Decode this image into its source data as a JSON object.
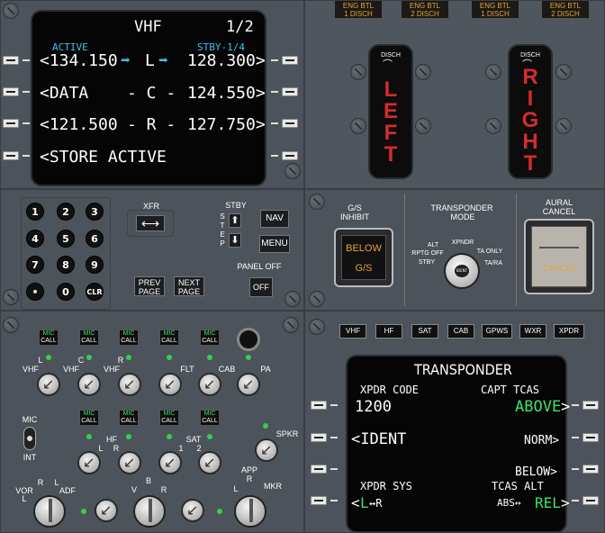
{
  "vhf": {
    "title": "VHF",
    "page": "1/2",
    "active_label": "ACTIVE",
    "stby_label": "STBY-1/4",
    "row1_left": "<134.150",
    "row1_mid": "L",
    "row1_right": "128.300>",
    "row2_left": "<DATA",
    "row2_mid": "- C -",
    "row2_right": "124.550>",
    "row3_left": "<121.500",
    "row3_mid": "- R -",
    "row3_right": "127.750>",
    "row4_left": "<STORE ACTIVE"
  },
  "keypad": {
    "keys": [
      "1",
      "2",
      "3",
      "4",
      "5",
      "6",
      "7",
      "8",
      "9",
      "•",
      "0",
      "CLR"
    ],
    "xfr_label": "XFR",
    "stby_label": "STBY",
    "step_letters": [
      "S",
      "T",
      "E",
      "P"
    ],
    "nav_label": "NAV",
    "menu_label": "MENU",
    "panel_off_label": "PANEL OFF",
    "off_label": "OFF",
    "prev_page_1": "PREV",
    "prev_page_2": "PAGE",
    "next_page_1": "NEXT",
    "next_page_2": "PAGE"
  },
  "fire": {
    "eng_btl_labels": [
      {
        "l1": "ENG BTL",
        "l2": "1 DISCH"
      },
      {
        "l1": "ENG BTL",
        "l2": "2 DISCH"
      },
      {
        "l1": "ENG BTL",
        "l2": "1 DISCH"
      },
      {
        "l1": "ENG BTL",
        "l2": "2 DISCH"
      }
    ],
    "disch_label": "DISCH",
    "left_letters": [
      "L",
      "E",
      "F",
      "T"
    ],
    "right_letters": [
      "R",
      "I",
      "G",
      "H",
      "T"
    ]
  },
  "gs": {
    "title1": "G/S",
    "title2": "INHIBIT",
    "below": "BELOW",
    "gs": "G/S"
  },
  "transponder_mode": {
    "title1": "TRANSPONDER",
    "title2": "MODE",
    "alt_rptg_off_1": "ALT",
    "alt_rptg_off_2": "RPTG OFF",
    "stby": "STBY",
    "xpndr": "XPNDR",
    "ta_only": "TA ONLY",
    "ta_ra": "TA/RA",
    "knob_label": "IDENT"
  },
  "aural": {
    "title1": "AURAL",
    "title2": "CANCEL",
    "cancel": "CANCEL"
  },
  "audio": {
    "mic_label": "MIC",
    "call_label": "CALL",
    "row1_names": [
      "VHF",
      "VHF",
      "VHF",
      "FLT",
      "CAB",
      "PA"
    ],
    "row1_side": [
      "L",
      "C",
      "R",
      "",
      "",
      ""
    ],
    "row2_names": [
      "HF",
      "SAT"
    ],
    "row2_subs": [
      "L",
      "R",
      "1",
      "2"
    ],
    "mic_int_top": "MIC",
    "mic_int_bottom": "INT",
    "spkr": "SPKR",
    "vor": "VOR",
    "adf": "ADF",
    "vor_l": "L",
    "vor_r": "R",
    "adf_l": "L",
    "v": "V",
    "b": "B",
    "r": "R",
    "app": "APP",
    "mkr": "MKR",
    "app_l": "L",
    "app_r": "R"
  },
  "xpdr_tabs": [
    "VHF",
    "HF",
    "SAT",
    "CAB",
    "GPWS",
    "WXR",
    "XPDR"
  ],
  "xpdr_cdu": {
    "title": "TRANSPONDER",
    "xpdr_code_label": "XPDR CODE",
    "capt_tcas_label": "CAPT TCAS",
    "code": "1200",
    "above": "ABOVE",
    "ident": "<IDENT",
    "norm": "NORM>",
    "below": "BELOW>",
    "xpdr_sys_label": "XPDR SYS",
    "tcas_alt_label": "TCAS ALT",
    "sys_value_l": "L",
    "sys_value_arrow": "↔R",
    "abs_label": "ABS↔",
    "rel_label": "REL"
  }
}
